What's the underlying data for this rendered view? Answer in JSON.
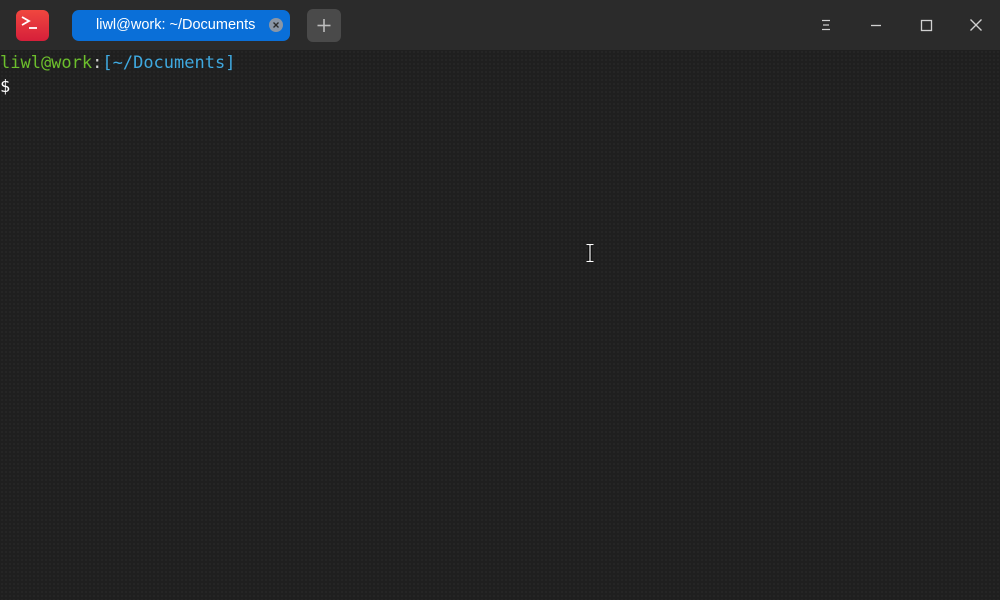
{
  "window": {
    "app_icon": "terminal-app-icon",
    "tab": {
      "label": "liwl@work: ~/Documents",
      "close_icon": "close-icon"
    },
    "new_tab_icon": "plus-icon",
    "controls": [
      "menu-icon",
      "minimize-icon",
      "maximize-icon",
      "close-icon"
    ]
  },
  "terminal": {
    "prompt_line": {
      "user_host": "liwl@work",
      "separator": ":",
      "path": "[~/Documents]"
    },
    "input_line": {
      "prompt_symbol": "$"
    }
  },
  "colors": {
    "tab_active": "#0a6fd8",
    "user_host": "#6cbf2c",
    "path": "#3fa9e0",
    "background": "#1f1f1f",
    "titlebar": "#2b2b2b",
    "app_icon": "#e0303c"
  }
}
